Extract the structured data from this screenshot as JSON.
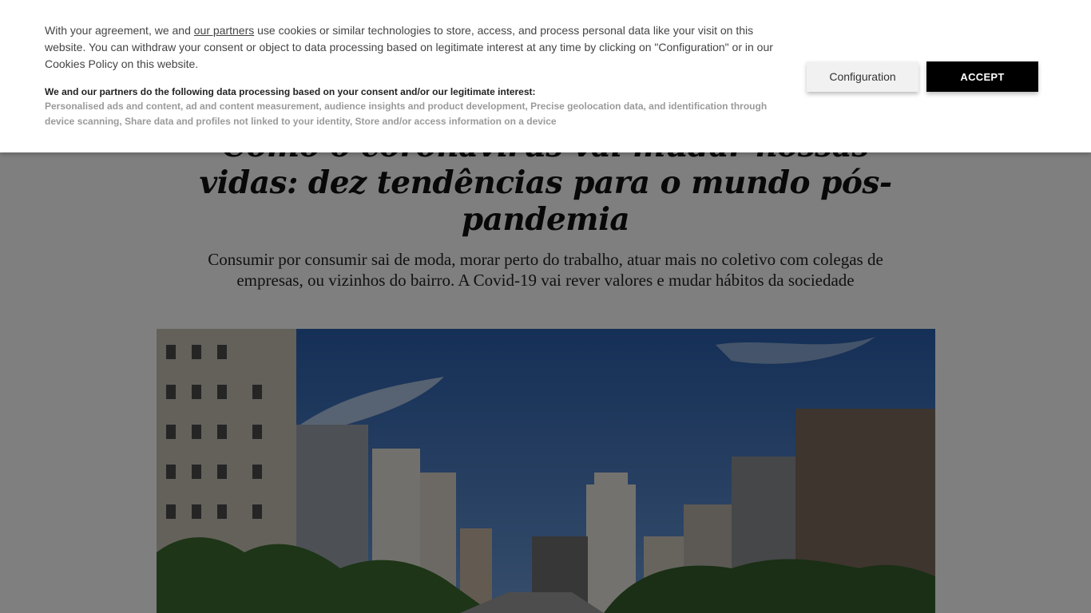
{
  "article": {
    "headline": "Como o coronavírus vai mudar nossas vidas: dez tendências para o mundo pós-pandemia",
    "subtitle": "Consumir por consumir sai de moda, morar perto do trabalho, atuar mais no coletivo com colegas de empresas, ou vizinhos do bairro. A Covid-19 vai rever valores e mudar hábitos da sociedade"
  },
  "cookie_banner": {
    "intro_before_link": "With your agreement, we and ",
    "partners_link": "our partners",
    "intro_after_link": " use cookies or similar technologies to store, access, and process personal data like your visit on this website. You can withdraw your consent or object to data processing based on legitimate interest at any time by clicking on \"Configuration\" or in our Cookies Policy on this website.",
    "processing_heading": "We and our partners do the following data processing based on your consent and/or our legitimate interest:",
    "processing_purposes": "Personalised ads and content, ad and content measurement, audience insights and product development, Precise geolocation data, and identification through device scanning, Share data and profiles not linked to your identity, Store and/or access information on a device",
    "configuration_label": "Configuration",
    "accept_label": "ACCEPT"
  },
  "colors": {
    "accept_bg": "#000000",
    "overlay": "rgba(0,0,0,0.5)",
    "purposes_text": "#9a9a9a"
  }
}
